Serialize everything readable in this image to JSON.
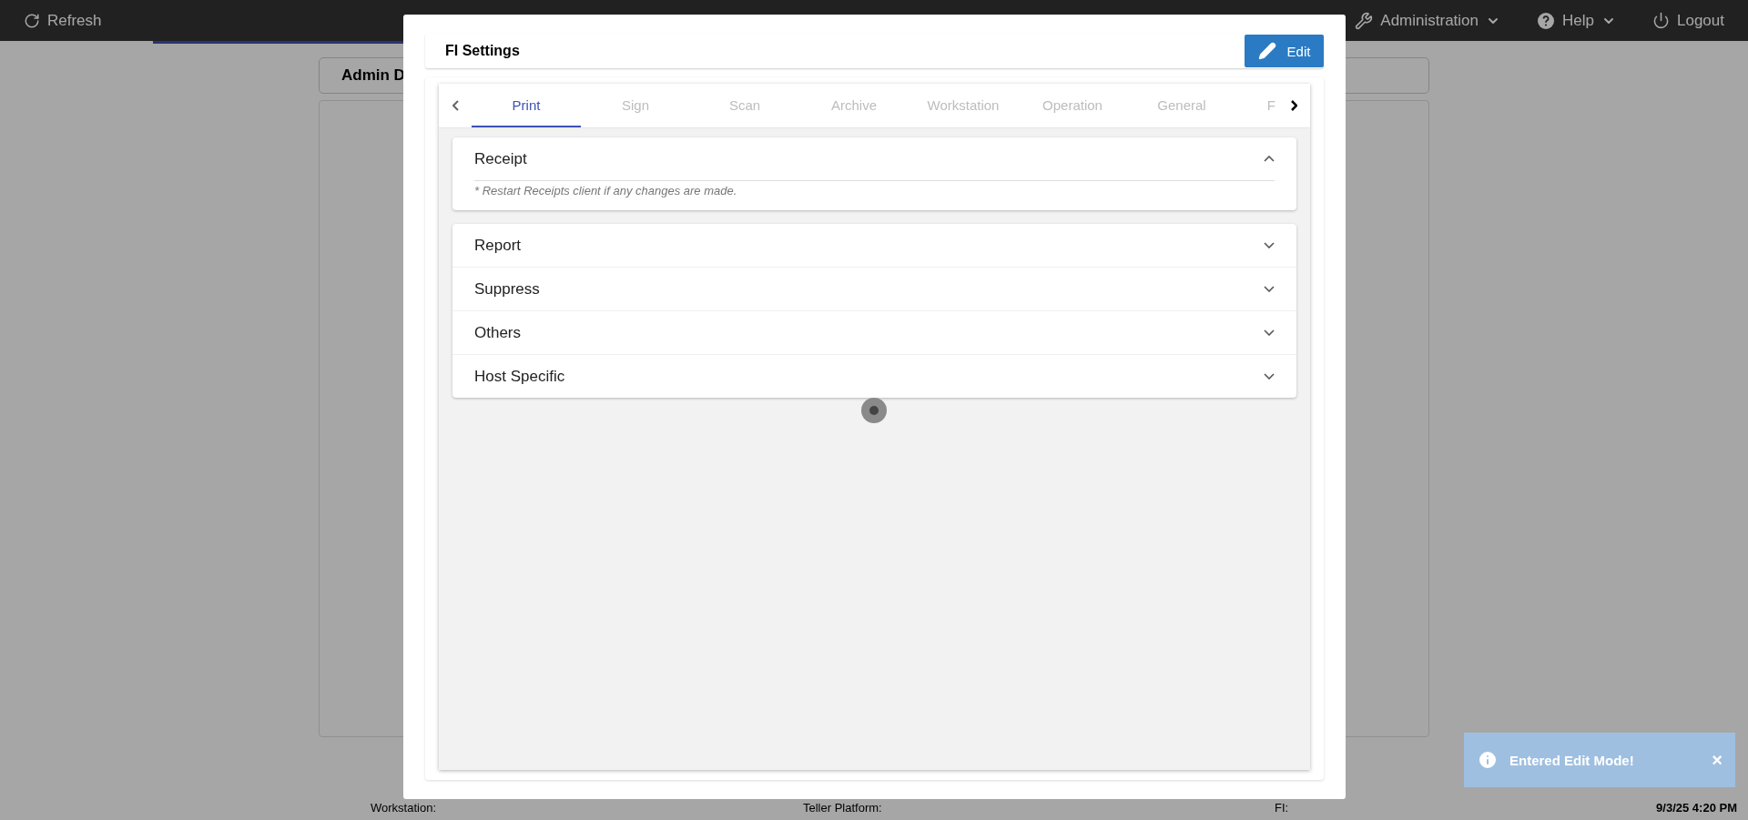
{
  "top_bar": {
    "refresh": "Refresh",
    "menus": [
      {
        "label": "Administration",
        "kind": "dropdown"
      },
      {
        "label": "Help",
        "kind": "dropdown"
      },
      {
        "label": "Logout",
        "kind": "button"
      }
    ]
  },
  "background_card": {
    "title": "Admin D"
  },
  "modal": {
    "title": "FI Settings",
    "edit_button": "Edit",
    "tabs": [
      {
        "label": "Print",
        "selected": true
      },
      {
        "label": "Sign",
        "selected": false
      },
      {
        "label": "Scan",
        "selected": false
      },
      {
        "label": "Archive",
        "selected": false
      },
      {
        "label": "Workstation",
        "selected": false
      },
      {
        "label": "Operation",
        "selected": false
      },
      {
        "label": "General",
        "selected": false
      },
      {
        "label": "F",
        "selected": false
      }
    ],
    "sections": [
      {
        "title": "Receipt",
        "expanded": true,
        "note": "* Restart Receipts client if any changes are made."
      },
      {
        "title": "Report",
        "expanded": false
      },
      {
        "title": "Suppress",
        "expanded": false
      },
      {
        "title": "Others",
        "expanded": false
      },
      {
        "title": "Host Specific",
        "expanded": false
      }
    ]
  },
  "status_bar": {
    "workstation": "Workstation:",
    "teller_platform": "Teller Platform:",
    "fi": "FI:",
    "datetime": "9/3/25 4:20 PM"
  },
  "toast": {
    "message": "Entered Edit Mode!",
    "close": "×"
  }
}
